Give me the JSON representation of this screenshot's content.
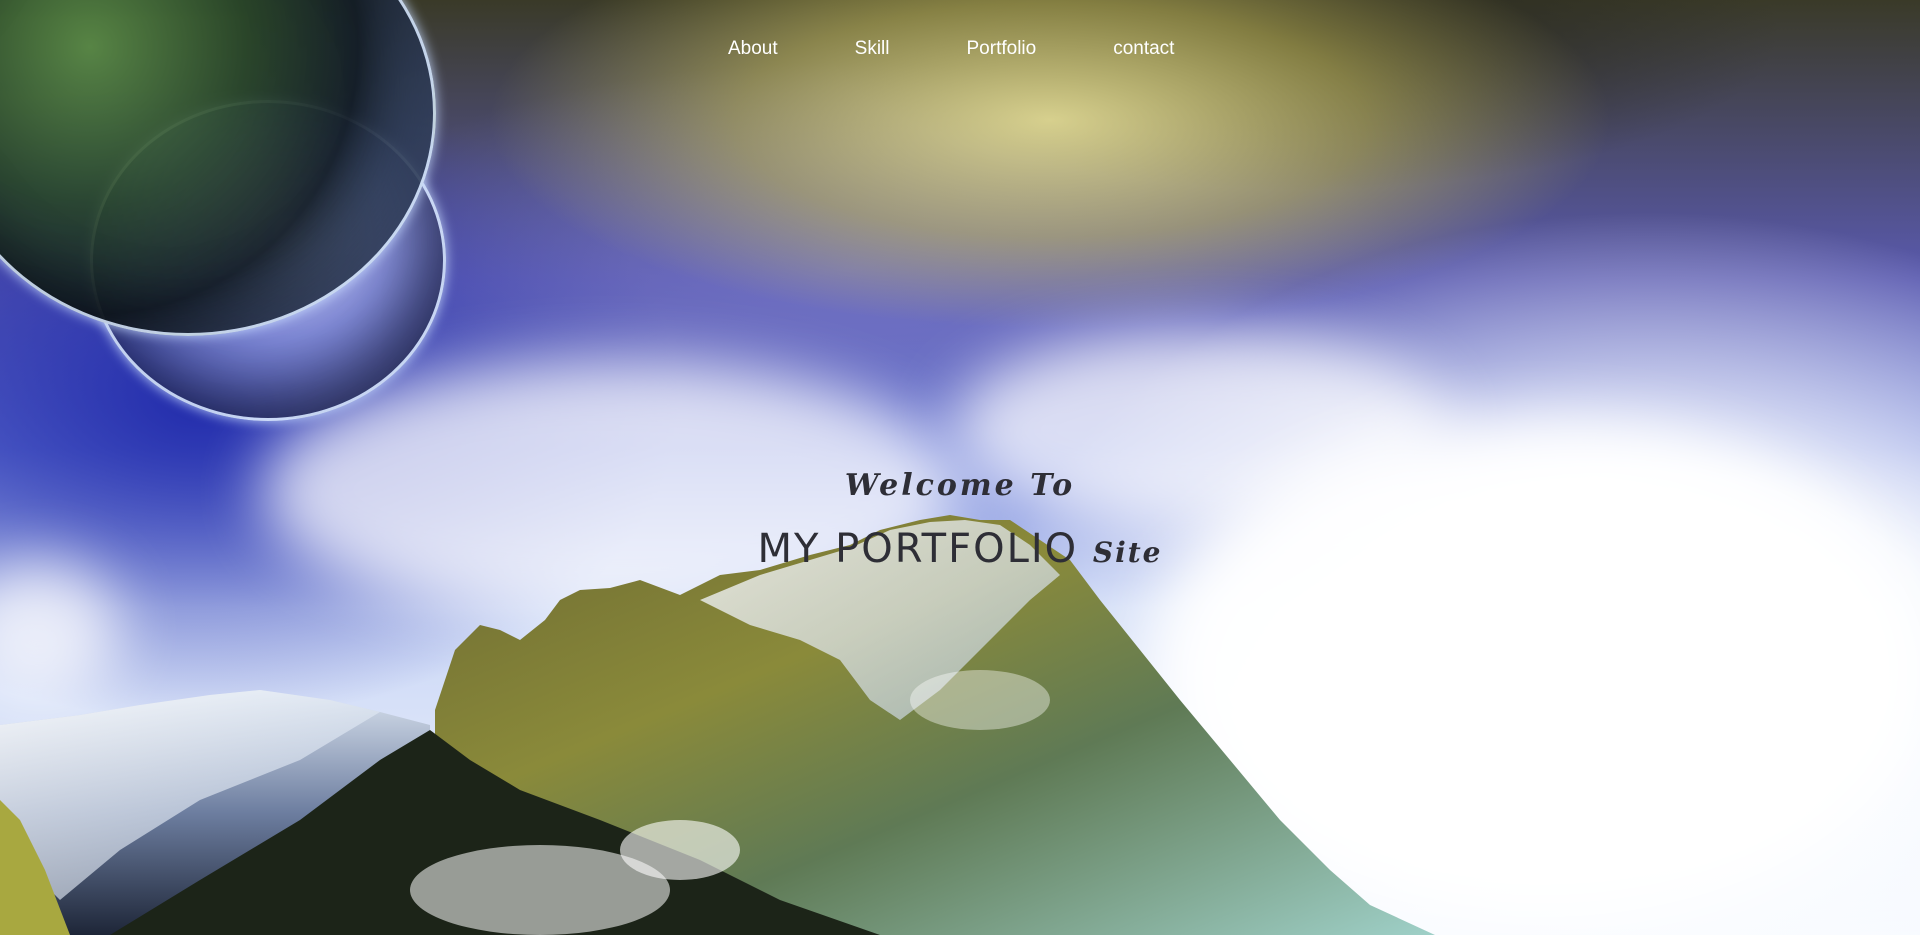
{
  "nav": {
    "items": [
      {
        "label": "About"
      },
      {
        "label": "Skill"
      },
      {
        "label": "Portfolio"
      },
      {
        "label": "contact"
      }
    ]
  },
  "hero": {
    "welcome": "Welcome To",
    "title_main": "MY PORTFOLIO",
    "title_suffix": "Site"
  },
  "colors": {
    "nav_text": "#ffffff",
    "headline_text": "#2e2e36"
  }
}
